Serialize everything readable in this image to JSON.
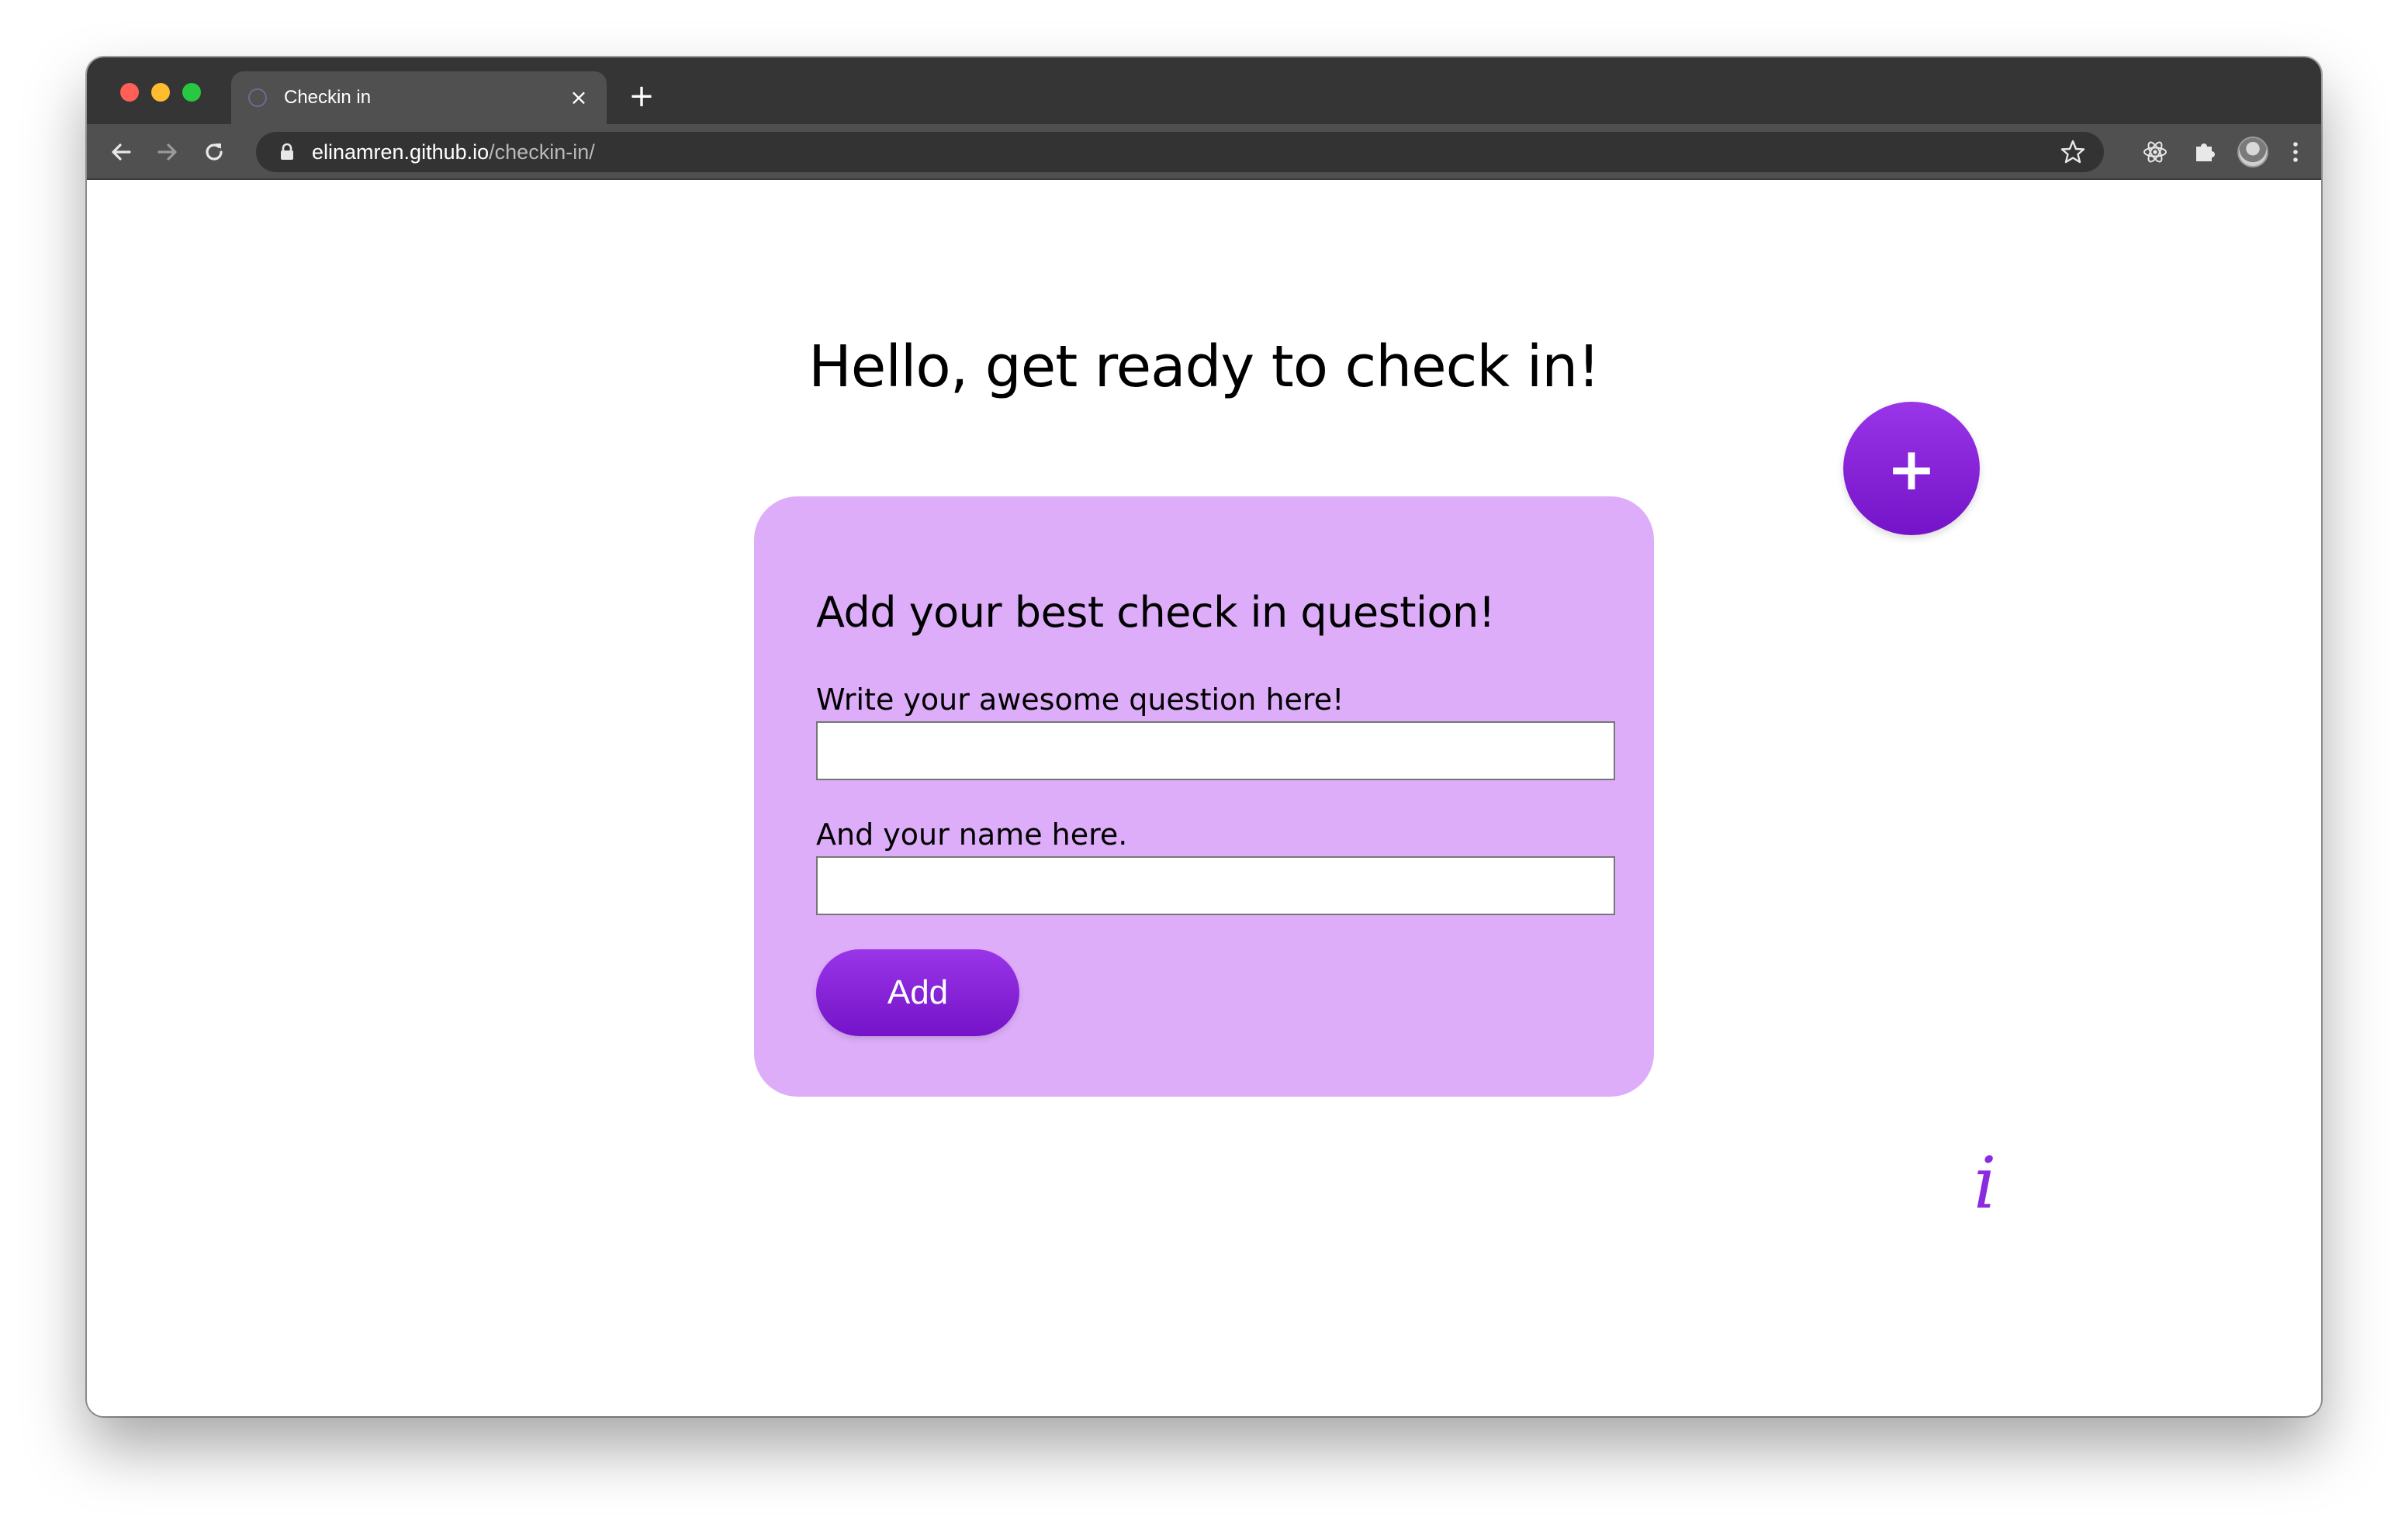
{
  "browser": {
    "tab": {
      "title": "Checkin in"
    },
    "tab_close_symbol": "×",
    "new_tab_symbol": "+",
    "url": {
      "host": "elinamren.github.io",
      "path": "/checkin-in/"
    },
    "icons": {
      "back": "arrow-left-icon",
      "forward": "arrow-right-icon",
      "reload": "reload-icon",
      "lock": "lock-icon",
      "bookmark": "star-icon",
      "react_devtools": "react-icon",
      "extensions": "puzzle-icon",
      "profile": "avatar",
      "menu": "kebab-menu-icon"
    }
  },
  "page": {
    "title": "Hello, get ready to check in!",
    "add_fab_symbol": "+",
    "form": {
      "heading": "Add your best check in question!",
      "question_label": "Write your awesome question here!",
      "question_value": "",
      "name_label": "And your name here.",
      "name_value": "",
      "add_button_label": "Add"
    },
    "info_symbol": "i"
  },
  "colors": {
    "accent_purple": "#8a2be2",
    "card_background": "#ddadfa",
    "button_gradient_top": "#9a35e8",
    "button_gradient_bottom": "#7413c8"
  }
}
